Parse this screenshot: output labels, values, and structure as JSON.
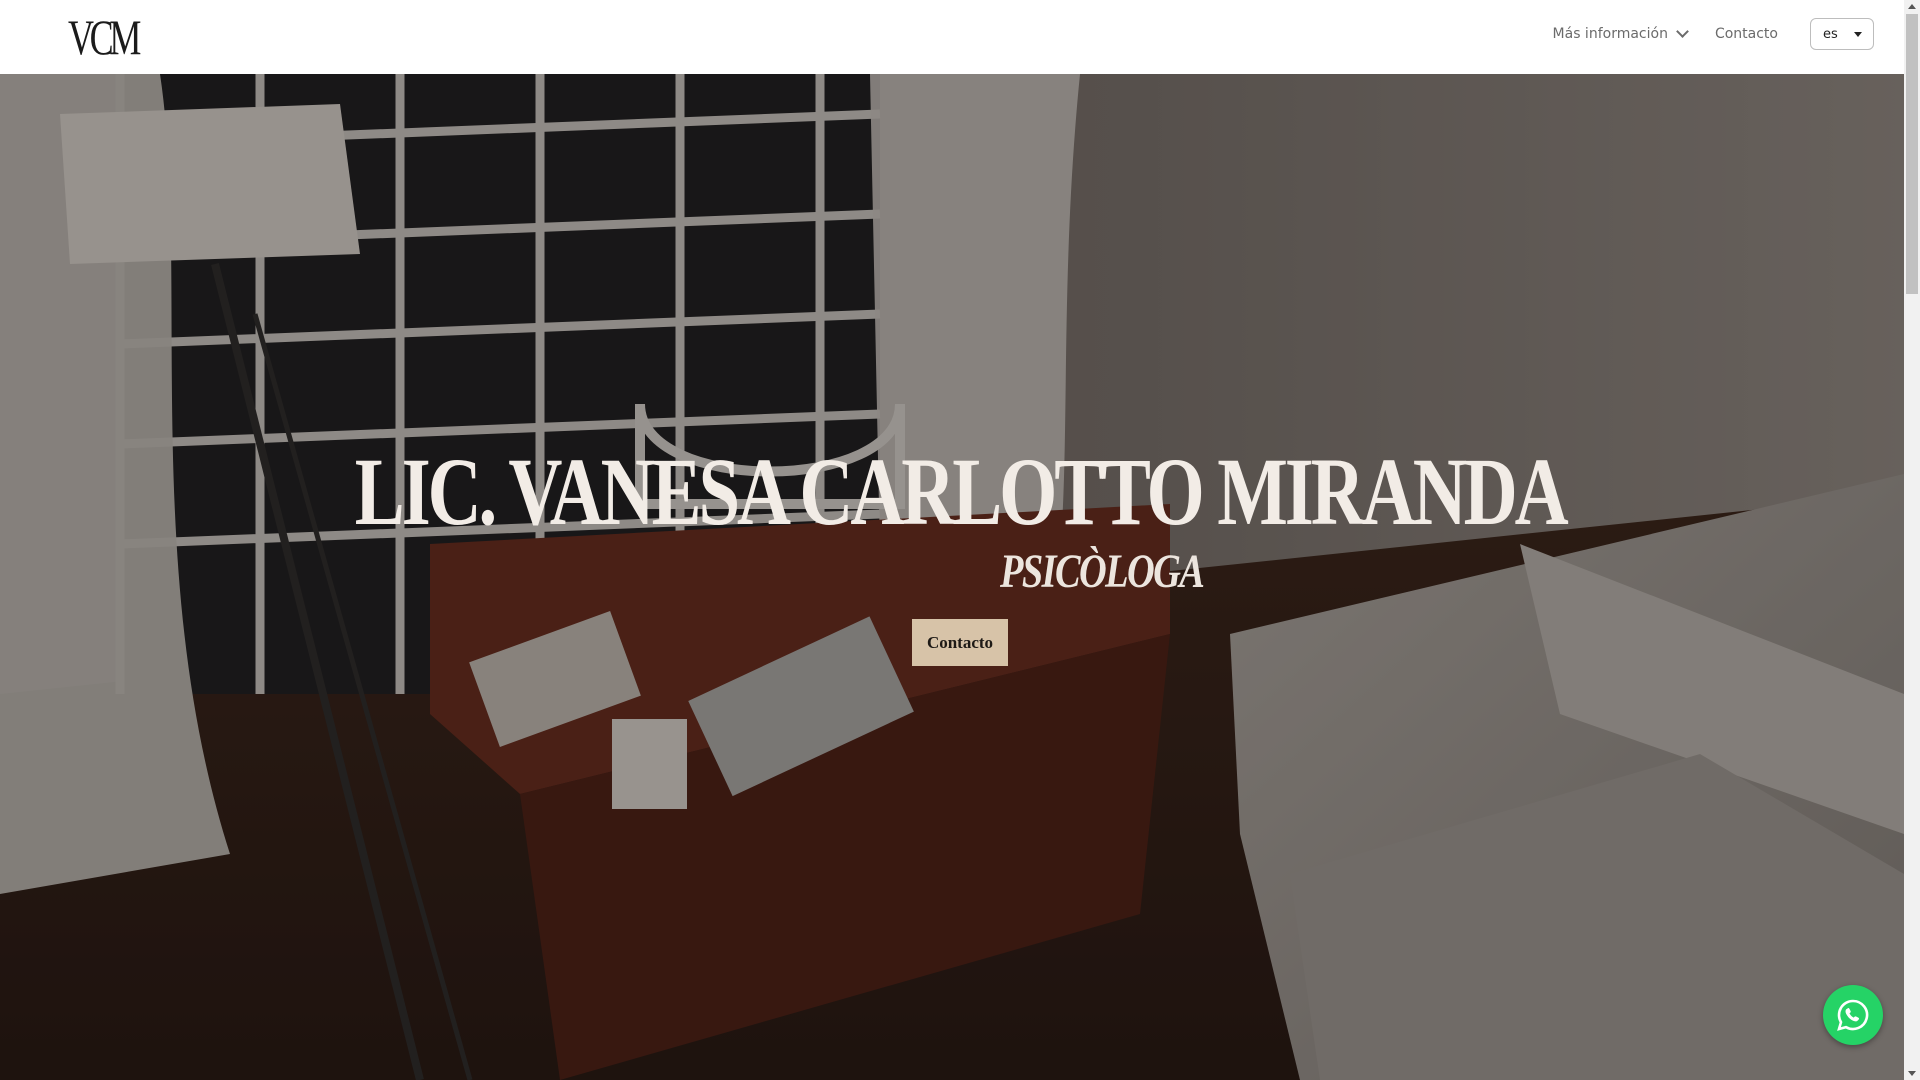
{
  "brand": {
    "logo_text": "VCM"
  },
  "nav": {
    "more_info_label": "Más información",
    "contact_label": "Contacto",
    "language_value": "es"
  },
  "hero": {
    "title": "LIC. VANESA CARLOTTO MIRANDA",
    "subtitle": "PSICÒLOGA",
    "cta_label": "Contacto"
  },
  "colors": {
    "navbar_bg": "#ffffff",
    "cta_bg": "#d7c3a8",
    "whatsapp": "#25d366",
    "hero_text": "#f2ece6"
  },
  "icons": {
    "more_info": "chevron-down-icon",
    "language": "caret-down-icon",
    "floating": "whatsapp-icon"
  }
}
